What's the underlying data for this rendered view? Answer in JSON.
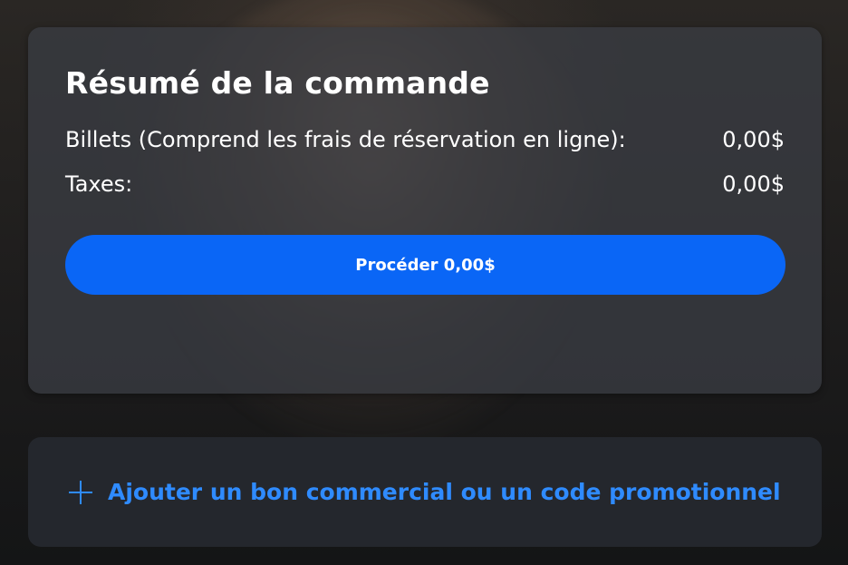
{
  "summary": {
    "title": "Résumé de la commande",
    "tickets_label": "Billets (Comprend les frais de réservation en ligne):",
    "tickets_value": "0,00$",
    "taxes_label": "Taxes:",
    "taxes_value": "0,00$",
    "proceed_label": "Procéder 0,00$"
  },
  "promo": {
    "link_label": "Ajouter un bon commercial ou un code promotionnel",
    "icon": "plus-icon"
  },
  "colors": {
    "accent": "#0a66f6",
    "link": "#2f8bff",
    "card": "#3a3c42",
    "promo_card": "#24272d"
  }
}
